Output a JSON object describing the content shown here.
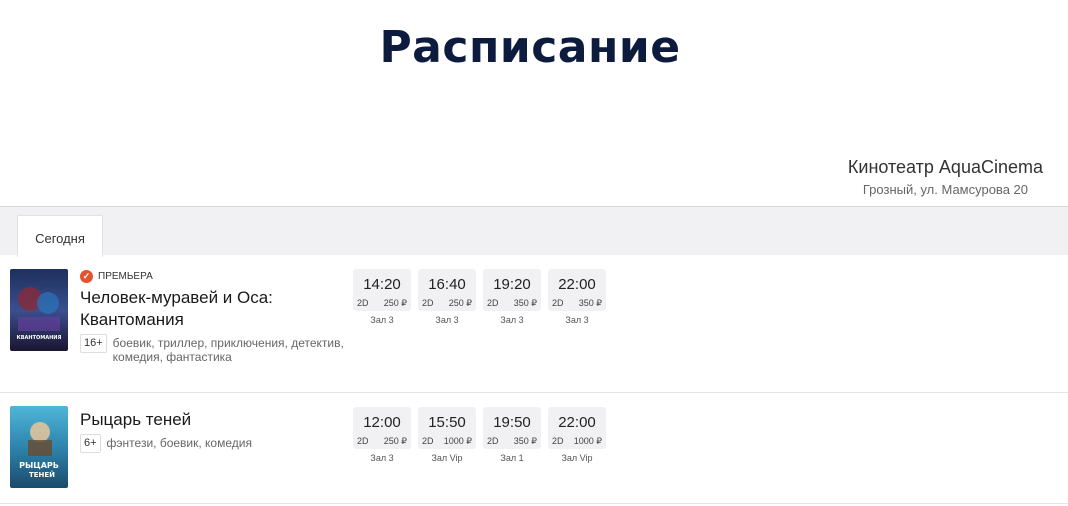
{
  "page_title": "Расписание",
  "cinema": {
    "name": "Кинотеатр AquaCinema",
    "address": "Грозный, ул. Мамсурова 20"
  },
  "tabs": [
    {
      "label": "Сегодня",
      "active": true
    }
  ],
  "movies": [
    {
      "badge": "ПРЕМЬЕРА",
      "badge_icon": "premiere-icon",
      "title_line1": "Человек-муравей и Оса:",
      "title_line2": "Квантомания",
      "age": "16+",
      "genres": "боевик, триллер, приключения, детектив, комедия, фантастика",
      "poster_caption": "КВАНТОМАНИЯ",
      "sessions": [
        {
          "time": "14:20",
          "format": "2D",
          "price": "250 ₽",
          "hall": "Зал 3"
        },
        {
          "time": "16:40",
          "format": "2D",
          "price": "250 ₽",
          "hall": "Зал 3"
        },
        {
          "time": "19:20",
          "format": "2D",
          "price": "350 ₽",
          "hall": "Зал 3"
        },
        {
          "time": "22:00",
          "format": "2D",
          "price": "350 ₽",
          "hall": "Зал 3"
        }
      ]
    },
    {
      "title_line1": "Рыцарь теней",
      "age": "6+",
      "genres": "фэнтези, боевик, комедия",
      "poster_caption_1": "РЫЦАРЬ",
      "poster_caption_2": "ТЕНЕЙ",
      "sessions": [
        {
          "time": "12:00",
          "format": "2D",
          "price": "250 ₽",
          "hall": "Зал 3"
        },
        {
          "time": "15:50",
          "format": "2D",
          "price": "1000 ₽",
          "hall": "Зал Vip"
        },
        {
          "time": "19:50",
          "format": "2D",
          "price": "350 ₽",
          "hall": "Зал 1"
        },
        {
          "time": "22:00",
          "format": "2D",
          "price": "1000 ₽",
          "hall": "Зал Vip"
        }
      ]
    }
  ]
}
